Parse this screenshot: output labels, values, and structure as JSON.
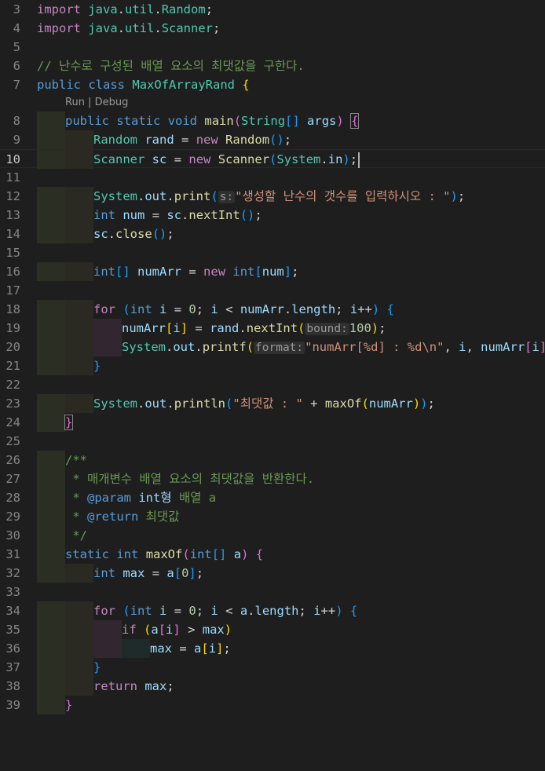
{
  "editor": {
    "line_numbers": [
      "3",
      "4",
      "5",
      "6",
      "7",
      "8",
      "9",
      "10",
      "11",
      "12",
      "13",
      "14",
      "15",
      "16",
      "17",
      "18",
      "19",
      "20",
      "21",
      "22",
      "23",
      "24",
      "25",
      "26",
      "27",
      "28",
      "29",
      "30",
      "31",
      "32",
      "33",
      "34",
      "35",
      "36",
      "37",
      "38",
      "39"
    ],
    "code_lens": "Run | Debug",
    "lines": {
      "l3": [
        "import",
        "java",
        ".",
        "util",
        ".",
        "Random",
        ";"
      ],
      "l4": [
        "import",
        "java",
        ".",
        "util",
        ".",
        "Scanner",
        ";"
      ],
      "l6": "// 난수로 구성된 배열 요소의 최댓값을 구한다.",
      "l7": [
        "public",
        "class",
        "MaxOfArrayRand",
        "{"
      ],
      "l8": [
        "public",
        "static",
        "void",
        "main",
        "(",
        "String",
        "[]",
        "args",
        ")",
        "{"
      ],
      "l9": [
        "Random",
        "rand",
        "=",
        "new",
        "Random",
        "()",
        ";"
      ],
      "l10": [
        "Scanner",
        "sc",
        "=",
        "new",
        "Scanner",
        "(",
        "System",
        ".",
        "in",
        ")",
        ";"
      ],
      "l12": [
        "System",
        ".",
        "out",
        ".",
        "print",
        "(",
        "s:",
        "\"생성할 난수의 갯수를 입력하시오 : \"",
        ")",
        ";"
      ],
      "l13": [
        "int",
        "num",
        "=",
        "sc",
        ".",
        "nextInt",
        "()",
        ";"
      ],
      "l14": [
        "sc",
        ".",
        "close",
        "()",
        ";"
      ],
      "l16": [
        "int",
        "[]",
        "numArr",
        "=",
        "new",
        "int",
        "[",
        "num",
        "]",
        ";"
      ],
      "l18": [
        "for",
        "(",
        "int",
        "i",
        "=",
        "0",
        ";",
        "i",
        "<",
        "numArr",
        ".",
        "length",
        ";",
        "i",
        "++",
        ")",
        "{"
      ],
      "l19": [
        "numArr",
        "[",
        "i",
        "]",
        "=",
        "rand",
        ".",
        "nextInt",
        "(",
        "bound:",
        "100",
        ")",
        ";"
      ],
      "l20": [
        "System",
        ".",
        "out",
        ".",
        "printf",
        "(",
        "format:",
        "\"numArr[%d] : %d\\n\"",
        ",",
        "i",
        ",",
        "numArr",
        "[",
        "i",
        "]",
        ")",
        ";"
      ],
      "l21": "}",
      "l23": [
        "System",
        ".",
        "out",
        ".",
        "println",
        "(",
        "\"최댓값 : \"",
        "+",
        "maxOf",
        "(",
        "numArr",
        ")",
        ")",
        ";"
      ],
      "l24": "}",
      "l26": "/**",
      "l27": " * 매개변수 배열 요소의 최댓값을 반환한다.",
      "l28": [
        " * ",
        "@param",
        "int",
        "형",
        "배열 a"
      ],
      "l29": [
        " * ",
        "@return",
        "최댓값"
      ],
      "l30": " */",
      "l31": [
        "static",
        "int",
        "maxOf",
        "(",
        "int",
        "[]",
        "a",
        ")",
        "{"
      ],
      "l32": [
        "int",
        "max",
        "=",
        "a",
        "[",
        "0",
        "]",
        ";"
      ],
      "l34": [
        "for",
        "(",
        "int",
        "i",
        "=",
        "0",
        ";",
        "i",
        "<",
        "a",
        ".",
        "length",
        ";",
        "i",
        "++",
        ")",
        "{"
      ],
      "l35": [
        "if",
        "(",
        "a",
        "[",
        "i",
        "]",
        ">",
        "max",
        ")"
      ],
      "l36": [
        "max",
        "=",
        "a",
        "[",
        "i",
        "]",
        ";"
      ],
      "l37": "}",
      "l38": [
        "return",
        "max",
        ";"
      ],
      "l39": "}"
    }
  },
  "icons": {
    "lightbulb": "lightbulb-icon"
  },
  "colors": {
    "background": "#1e1e1e",
    "keyword": "#569cd6",
    "control": "#c586c0",
    "type": "#4ec9b0",
    "function": "#dcdcaa",
    "variable": "#9cdcfe",
    "number": "#b5cea8",
    "string": "#ce9178",
    "comment": "#6a9955"
  }
}
